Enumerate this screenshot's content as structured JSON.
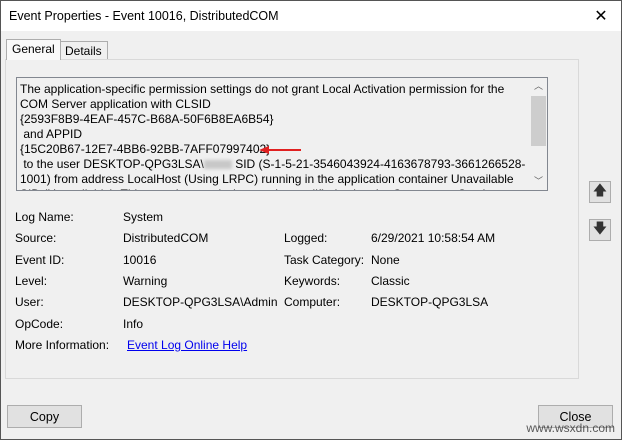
{
  "window": {
    "title": "Event Properties - Event 10016, DistributedCOM",
    "close_glyph": "✕"
  },
  "tabs": [
    {
      "label": "General"
    },
    {
      "label": "Details"
    }
  ],
  "description": {
    "before": "The application-specific permission settings do not grant Local Activation permission for the COM Server application with CLSID\n{2593F8B9-4EAF-457C-B68A-50F6B8EA6B54}\n and APPID\n{15C20B67-12E7-4BB6-92BB-7AFF07997402}\n to the user DESKTOP-QPG3LSA\\",
    "after": " SID (S-1-5-21-3546043924-4163678793-3661266528-1001) from address LocalHost (Using LRPC) running in the application container Unavailable SID (Unavailable). This security permission can be modified using the Component Services administrative tool."
  },
  "fields": {
    "log_name": {
      "label": "Log Name:",
      "value": "System"
    },
    "source": {
      "label": "Source:",
      "value": "DistributedCOM"
    },
    "logged": {
      "label": "Logged:",
      "value": "6/29/2021 10:58:54 AM"
    },
    "event_id": {
      "label": "Event ID:",
      "value": "10016"
    },
    "task_category": {
      "label": "Task Category:",
      "value": "None"
    },
    "level": {
      "label": "Level:",
      "value": "Warning"
    },
    "keywords": {
      "label": "Keywords:",
      "value": "Classic"
    },
    "user": {
      "label": "User:",
      "value": "DESKTOP-QPG3LSA\\Admin"
    },
    "computer": {
      "label": "Computer:",
      "value": "DESKTOP-QPG3LSA"
    },
    "opcode": {
      "label": "OpCode:",
      "value": "Info"
    },
    "more_info": {
      "label": "More Information:",
      "value": "Event Log Online Help"
    }
  },
  "buttons": {
    "copy": "Copy",
    "close": "Close"
  },
  "watermark": "www.wsxdn.com",
  "colors": {
    "link": "#0000ee",
    "annotation_arrow": "#e02020"
  }
}
